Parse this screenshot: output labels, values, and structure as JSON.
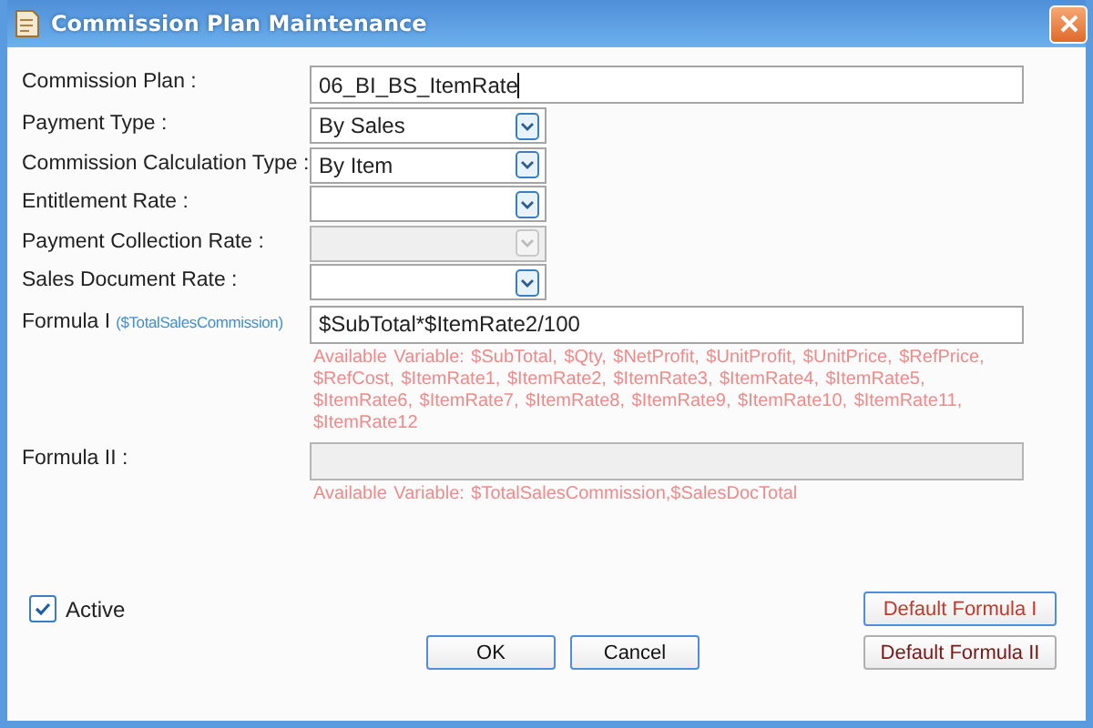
{
  "window": {
    "title": "Commission Plan Maintenance"
  },
  "fields": [
    {
      "kind": "text",
      "label": "Commission Plan :",
      "value": "06_BI_BS_ItemRate",
      "disabled": false
    },
    {
      "kind": "select",
      "label": "Payment Type :",
      "value": "By Sales",
      "disabled": false
    },
    {
      "kind": "select",
      "label": "Commission Calculation Type :",
      "value": "By Item",
      "disabled": false
    },
    {
      "kind": "select",
      "label": "Entitlement Rate :",
      "disabled": false
    },
    {
      "kind": "select",
      "label": "Payment Collection Rate :",
      "disabled": true
    },
    {
      "kind": "select",
      "label": "Sales Document Rate :",
      "disabled": false
    },
    {
      "kind": "formula",
      "label": "Formula I",
      "note": "($TotalSalesCommission)",
      "value": "$SubTotal*$ItemRate2/100",
      "disabled": false,
      "hint": "Available Variable: $SubTotal, $Qty, $NetProfit, $UnitProfit, $UnitPrice, $RefPrice, $RefCost,  $ItemRate1,  $ItemRate2,  $ItemRate3,  $ItemRate4,  $ItemRate5,  $ItemRate6,  $ItemRate7,  $ItemRate8,  $ItemRate9,  $ItemRate10,  $ItemRate11,  $ItemRate12"
    },
    {
      "kind": "formula",
      "label": "Formula II :",
      "disabled": true,
      "hint": "Available Variable: $TotalSalesCommission,$SalesDocTotal"
    }
  ],
  "active": {
    "label": "Active",
    "checked": true
  },
  "buttons": [
    {
      "label": "OK"
    },
    {
      "label": "Cancel"
    }
  ],
  "default_buttons": [
    {
      "label": "Default Formula I",
      "highlighted": true
    },
    {
      "label": "Default Formula II",
      "highlighted": false
    }
  ]
}
